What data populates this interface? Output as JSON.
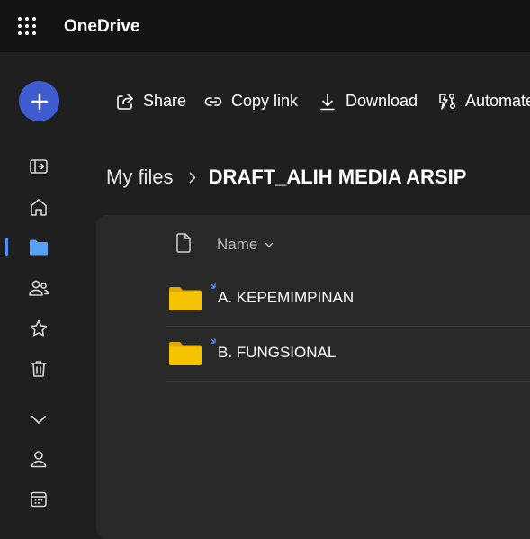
{
  "app": {
    "title": "OneDrive"
  },
  "commands": [
    {
      "id": "share",
      "label": "Share",
      "icon": "share-icon"
    },
    {
      "id": "copy-link",
      "label": "Copy link",
      "icon": "link-icon"
    },
    {
      "id": "download",
      "label": "Download",
      "icon": "download-icon"
    },
    {
      "id": "automate",
      "label": "Automate",
      "icon": "automate-icon"
    }
  ],
  "rail": [
    {
      "icon": "new-plus-icon"
    },
    {
      "icon": "sidebar-toggle-icon"
    },
    {
      "icon": "home-icon"
    },
    {
      "icon": "folder-icon",
      "active": true
    },
    {
      "icon": "people-icon"
    },
    {
      "icon": "star-icon"
    },
    {
      "icon": "trash-icon"
    },
    {
      "icon": "chevron-down-icon"
    },
    {
      "icon": "person-icon"
    },
    {
      "icon": "calendar-icon"
    }
  ],
  "breadcrumb": {
    "root": "My files",
    "current": "DRAFT_ALIH MEDIA ARSIP"
  },
  "list": {
    "name_header": "Name",
    "items": [
      {
        "name": "A. KEPEMIMPINAN",
        "type": "folder"
      },
      {
        "name": "B. FUNGSIONAL",
        "type": "folder"
      }
    ]
  },
  "colors": {
    "accent": "#4f8ff7",
    "new_button": "#3f5bd0",
    "folder": "#f5c400"
  }
}
